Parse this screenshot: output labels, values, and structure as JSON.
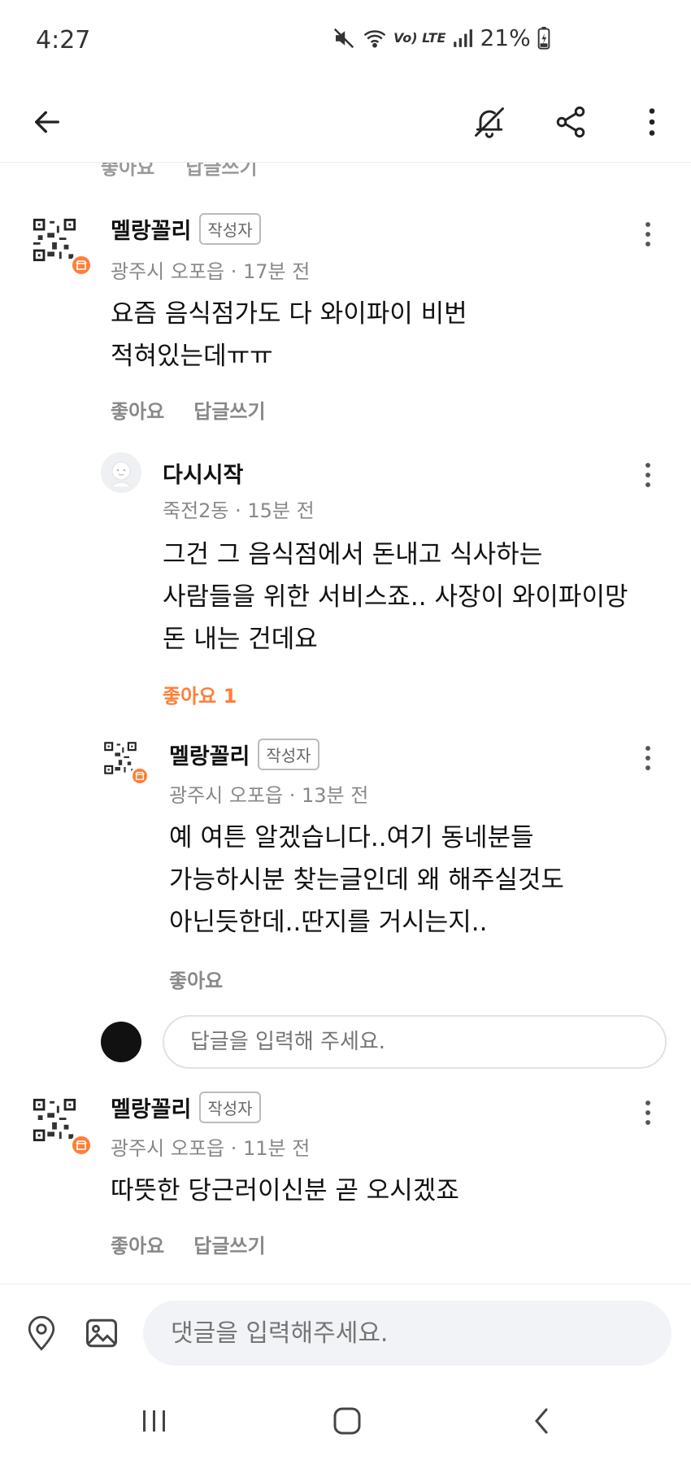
{
  "status_bar": {
    "time": "4:27",
    "network": "Vo) LTE",
    "battery": "21%"
  },
  "app_bar": {
    "back_icon": "back-arrow-icon",
    "mute_icon": "bell-off-icon",
    "share_icon": "share-icon",
    "more_icon": "more-vertical-icon"
  },
  "cut_row": {
    "like": "좋아요",
    "reply": "답글쓰기"
  },
  "comments": [
    {
      "author": "멜랑꼴리",
      "tag": "작성자",
      "meta": "광주시 오포읍 · 17분 전",
      "lines": [
        "요즘 음식점가도 다 와이파이 비번",
        "적혀있는데ㅠㅠ"
      ],
      "like": "좋아요",
      "reply": "답글쓰기"
    },
    {
      "author": "다시시작",
      "meta": "죽전2동 · 15분 전",
      "lines": [
        "그건 그 음식점에서 돈내고 식사하는",
        "사람들을 위한 서비스죠.. 사장이 와이파이망",
        "돈 내는 건데요"
      ],
      "like": "좋아요 1"
    },
    {
      "author": "멜랑꼴리",
      "tag": "작성자",
      "meta": "광주시 오포읍 · 13분 전",
      "lines": [
        "예 여튼 알겠습니다..여기 동네분들",
        "가능하시분 찾는글인데 왜 해주실것도",
        "아닌듯한데..딴지를 거시는지.."
      ],
      "like": "좋아요"
    },
    {
      "author": "멜랑꼴리",
      "tag": "작성자",
      "meta": "광주시 오포읍 · 11분 전",
      "lines": [
        "따뜻한 당근러이신분 곧 오시겠죠"
      ],
      "like": "좋아요",
      "reply": "답글쓰기"
    }
  ],
  "reply_input": {
    "placeholder": "답글을 입력해 주세요."
  },
  "bottom_bar": {
    "placeholder": "댓글을 입력해주세요.",
    "location_icon": "location-pin-icon",
    "image_icon": "image-icon"
  },
  "colors": {
    "accent": "#ff7e36",
    "muted": "#888888",
    "input_bg": "#f2f3f6"
  }
}
